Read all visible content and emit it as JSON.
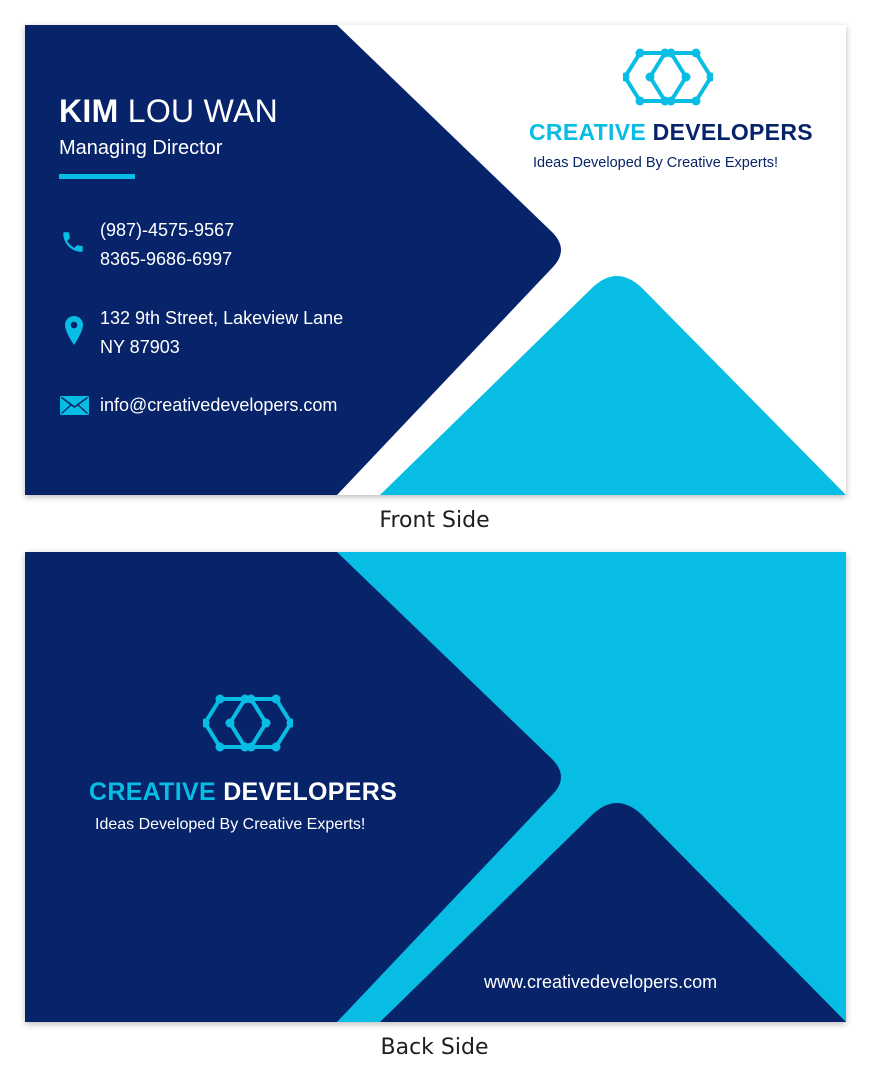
{
  "colors": {
    "navy": "#07246a",
    "cyan": "#08bde3",
    "white": "#ffffff"
  },
  "front": {
    "name_first": "KIM",
    "name_rest": " LOU WAN",
    "job_title": "Managing Director",
    "phone_1": "(987)-4575-9567",
    "phone_2": "8365-9686-6997",
    "address_1": "132 9th Street, Lakeview Lane",
    "address_2": "NY 87903",
    "email": "info@creativedevelopers.com",
    "brand_1": "CREATIVE",
    "brand_2": " DEVELOPERS",
    "tagline": "Ideas Developed By Creative Experts!",
    "icons": [
      "phone-icon",
      "location-pin-icon",
      "envelope-icon",
      "hexagon-logo-icon"
    ]
  },
  "back": {
    "brand_1": "CREATIVE",
    "brand_2": " DEVELOPERS",
    "tagline": "Ideas Developed By Creative Experts!",
    "website": "www.creativedevelopers.com",
    "icons": [
      "hexagon-logo-icon"
    ]
  },
  "captions": {
    "front": "Front Side",
    "back": "Back Side"
  }
}
